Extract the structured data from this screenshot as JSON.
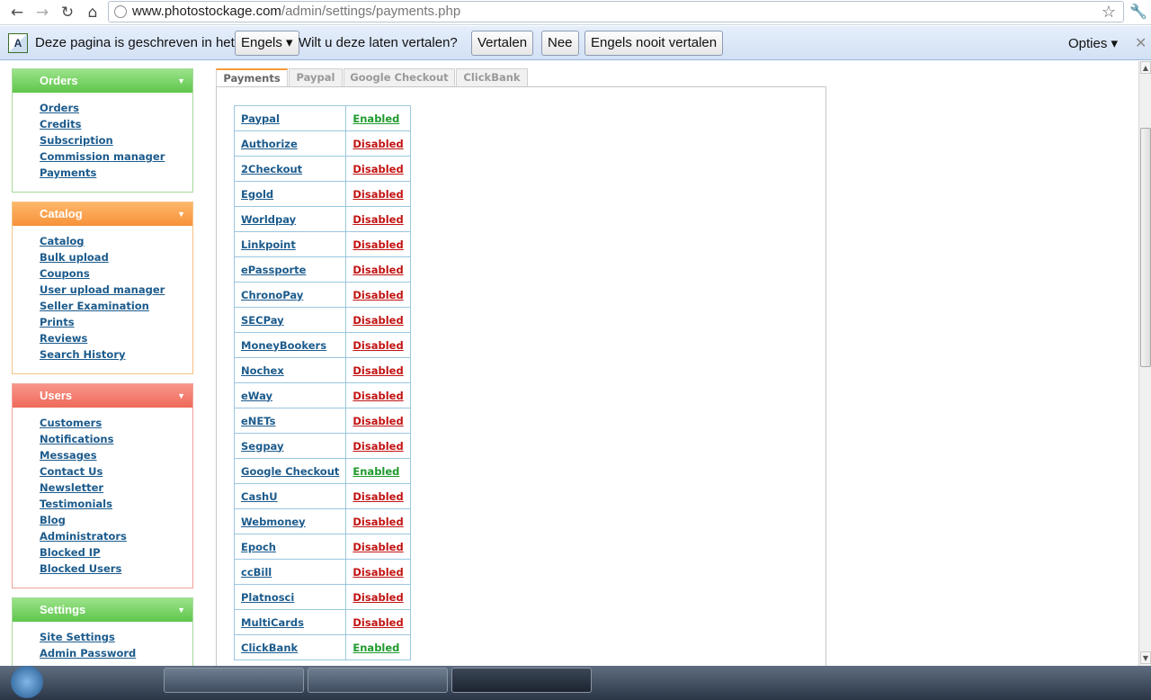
{
  "browser": {
    "url_host": "www.photostockage.com",
    "url_path": "/admin/settings/payments.php"
  },
  "infobar": {
    "text1": "Deze pagina is geschreven in het",
    "language": "Engels ▾",
    "text2": "Wilt u deze laten vertalen?",
    "translate": "Vertalen",
    "no": "Nee",
    "never": "Engels nooit vertalen",
    "options": "Opties ▾",
    "close": "✕"
  },
  "sidebar": {
    "orders": {
      "title": "Orders",
      "links": [
        "Orders",
        "Credits",
        "Subscription",
        "Commission manager",
        "Payments"
      ]
    },
    "catalog": {
      "title": "Catalog",
      "links": [
        "Catalog",
        "Bulk upload",
        "Coupons",
        "User upload manager",
        "Seller Examination",
        "Prints",
        "Reviews",
        "Search History"
      ]
    },
    "users": {
      "title": "Users",
      "links": [
        "Customers",
        "Notifications",
        "Messages",
        "Contact Us",
        "Newsletter",
        "Testimonials",
        "Blog",
        "Administrators",
        "Blocked IP",
        "Blocked Users"
      ]
    },
    "settings": {
      "title": "Settings",
      "links": [
        "Site Settings",
        "Admin Password"
      ]
    }
  },
  "tabs": [
    "Payments",
    "Paypal",
    "Google Checkout",
    "ClickBank"
  ],
  "payments": [
    {
      "name": "Paypal",
      "status": "Enabled"
    },
    {
      "name": "Authorize",
      "status": "Disabled"
    },
    {
      "name": "2Checkout",
      "status": "Disabled"
    },
    {
      "name": "Egold",
      "status": "Disabled"
    },
    {
      "name": "Worldpay",
      "status": "Disabled"
    },
    {
      "name": "Linkpoint",
      "status": "Disabled"
    },
    {
      "name": "ePassporte",
      "status": "Disabled"
    },
    {
      "name": "ChronoPay",
      "status": "Disabled"
    },
    {
      "name": "SECPay",
      "status": "Disabled"
    },
    {
      "name": "MoneyBookers",
      "status": "Disabled"
    },
    {
      "name": "Nochex",
      "status": "Disabled"
    },
    {
      "name": "eWay",
      "status": "Disabled"
    },
    {
      "name": "eNETs",
      "status": "Disabled"
    },
    {
      "name": "Segpay",
      "status": "Disabled"
    },
    {
      "name": "Google Checkout",
      "status": "Enabled"
    },
    {
      "name": "CashU",
      "status": "Disabled"
    },
    {
      "name": "Webmoney",
      "status": "Disabled"
    },
    {
      "name": "Epoch",
      "status": "Disabled"
    },
    {
      "name": "ccBill",
      "status": "Disabled"
    },
    {
      "name": "Platnosci",
      "status": "Disabled"
    },
    {
      "name": "MultiCards",
      "status": "Disabled"
    },
    {
      "name": "ClickBank",
      "status": "Enabled"
    }
  ],
  "colors": {
    "enabled": "#1f9a2d",
    "disabled": "#c21313",
    "link": "#1c5b8c",
    "active_tab_accent": "#f79a3a"
  }
}
